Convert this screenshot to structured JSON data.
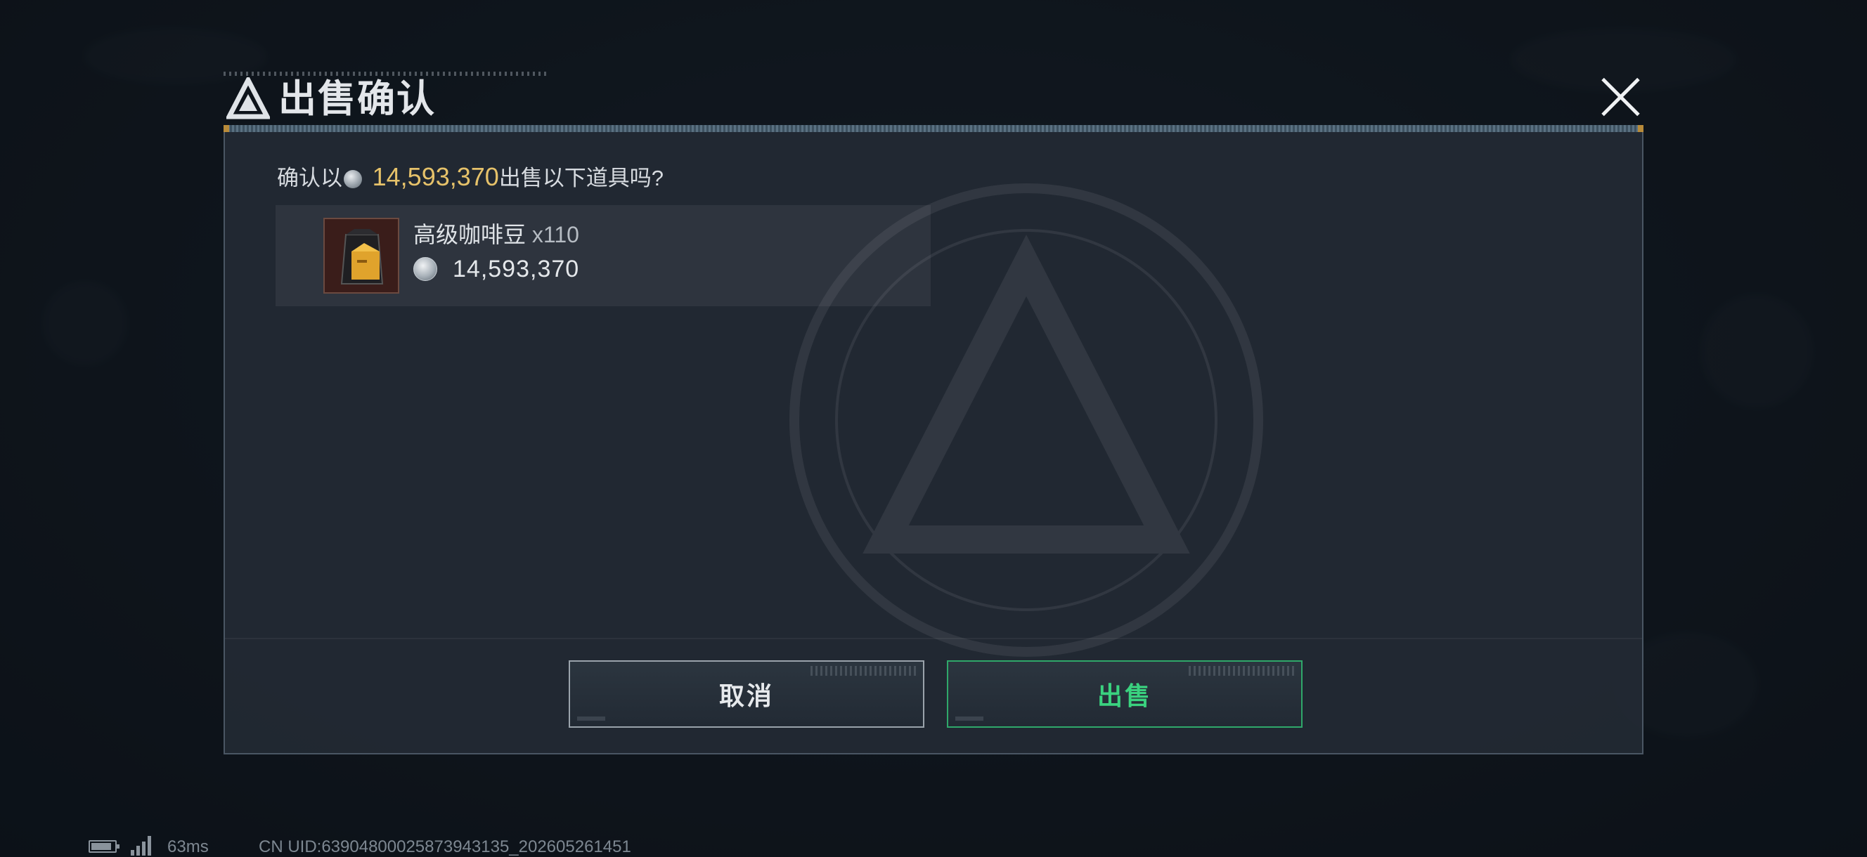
{
  "dialog": {
    "title": "出售确认",
    "question_prefix": "确认以",
    "question_amount": "14,593,370",
    "question_suffix": "出售以下道具吗?",
    "item": {
      "name": "高级咖啡豆",
      "quantity": "x110",
      "price": "14,593,370",
      "icon": "coffee-bag-icon"
    },
    "buttons": {
      "cancel": "取消",
      "sell": "出售"
    }
  },
  "status": {
    "ping": "63ms",
    "uid": "CN UID:639048000258739431​35_202605261451"
  },
  "colors": {
    "amount": "#e6c26a",
    "sell_accent": "#3ad27f",
    "dialog_bg": "#222a34"
  }
}
